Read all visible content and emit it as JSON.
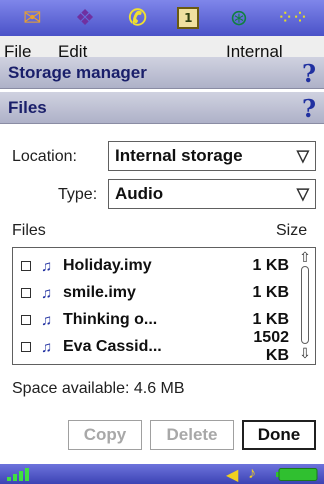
{
  "launcher": {
    "icons": [
      "messaging-icon",
      "planner-icon",
      "phone-icon",
      "calendar-icon",
      "web-icon",
      "more-apps-icon"
    ],
    "calendar_glyph": "1"
  },
  "menu": {
    "file": "File",
    "edit": "Edit",
    "location": "Internal"
  },
  "titlebars": [
    {
      "title": "Storage manager",
      "help": "?"
    },
    {
      "title": "Files",
      "help": "?"
    }
  ],
  "location": {
    "label": "Location:",
    "value": "Internal storage"
  },
  "type": {
    "label": "Type:",
    "value": "Audio"
  },
  "columns": {
    "files": "Files",
    "size": "Size"
  },
  "files": [
    {
      "name": "Holiday.imy",
      "size": "1 KB"
    },
    {
      "name": "smile.imy",
      "size": "1 KB"
    },
    {
      "name": "Thinking o...",
      "size": "1 KB"
    },
    {
      "name": "Eva Cassid...",
      "size": "1502 KB"
    }
  ],
  "space_available": "Space available: 4.6 MB",
  "buttons": {
    "copy": "Copy",
    "delete": "Delete",
    "done": "Done"
  },
  "colors": {
    "accent": "#4a52c8",
    "title_text": "#1a1f6a",
    "battery": "#30c030"
  }
}
